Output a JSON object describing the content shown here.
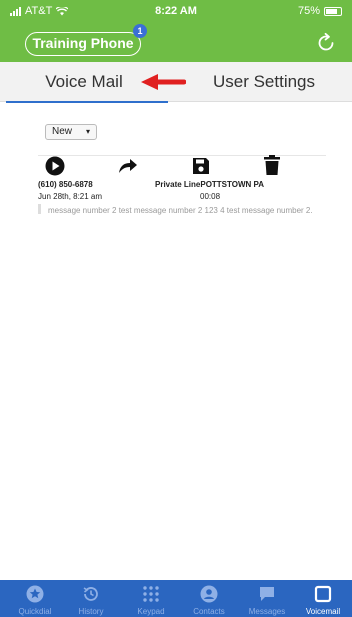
{
  "status_bar": {
    "carrier": "AT&T",
    "time": "8:22 AM",
    "battery": "75%",
    "battery_level": 0.75
  },
  "app_bar": {
    "phone_label": "Training Phone",
    "badge_count": "1"
  },
  "tabs": [
    {
      "label": "Voice Mail",
      "active": true
    },
    {
      "label": "User Settings",
      "active": false
    }
  ],
  "filter": {
    "selected": "New"
  },
  "voicemail": {
    "caller_number": "(610) 850-6878",
    "caller_location": "Private LinePOTTSTOWN PA",
    "received": "Jun 28th, 8:21 am",
    "duration": "00:08",
    "transcript": "message number 2 test message number 2 123 4 test message number 2."
  },
  "bottom_nav": [
    {
      "label": "Quickdial",
      "icon": "star-icon"
    },
    {
      "label": "History",
      "icon": "history-icon"
    },
    {
      "label": "Keypad",
      "icon": "keypad-icon"
    },
    {
      "label": "Contacts",
      "icon": "contact-icon"
    },
    {
      "label": "Messages",
      "icon": "messages-icon"
    },
    {
      "label": "Voicemail",
      "icon": "voicemail-icon"
    }
  ],
  "colors": {
    "brand_green": "#6fbd45",
    "nav_blue": "#2b66c0",
    "accent_blue": "#2e6fcc",
    "annotation_red": "#e02020"
  }
}
